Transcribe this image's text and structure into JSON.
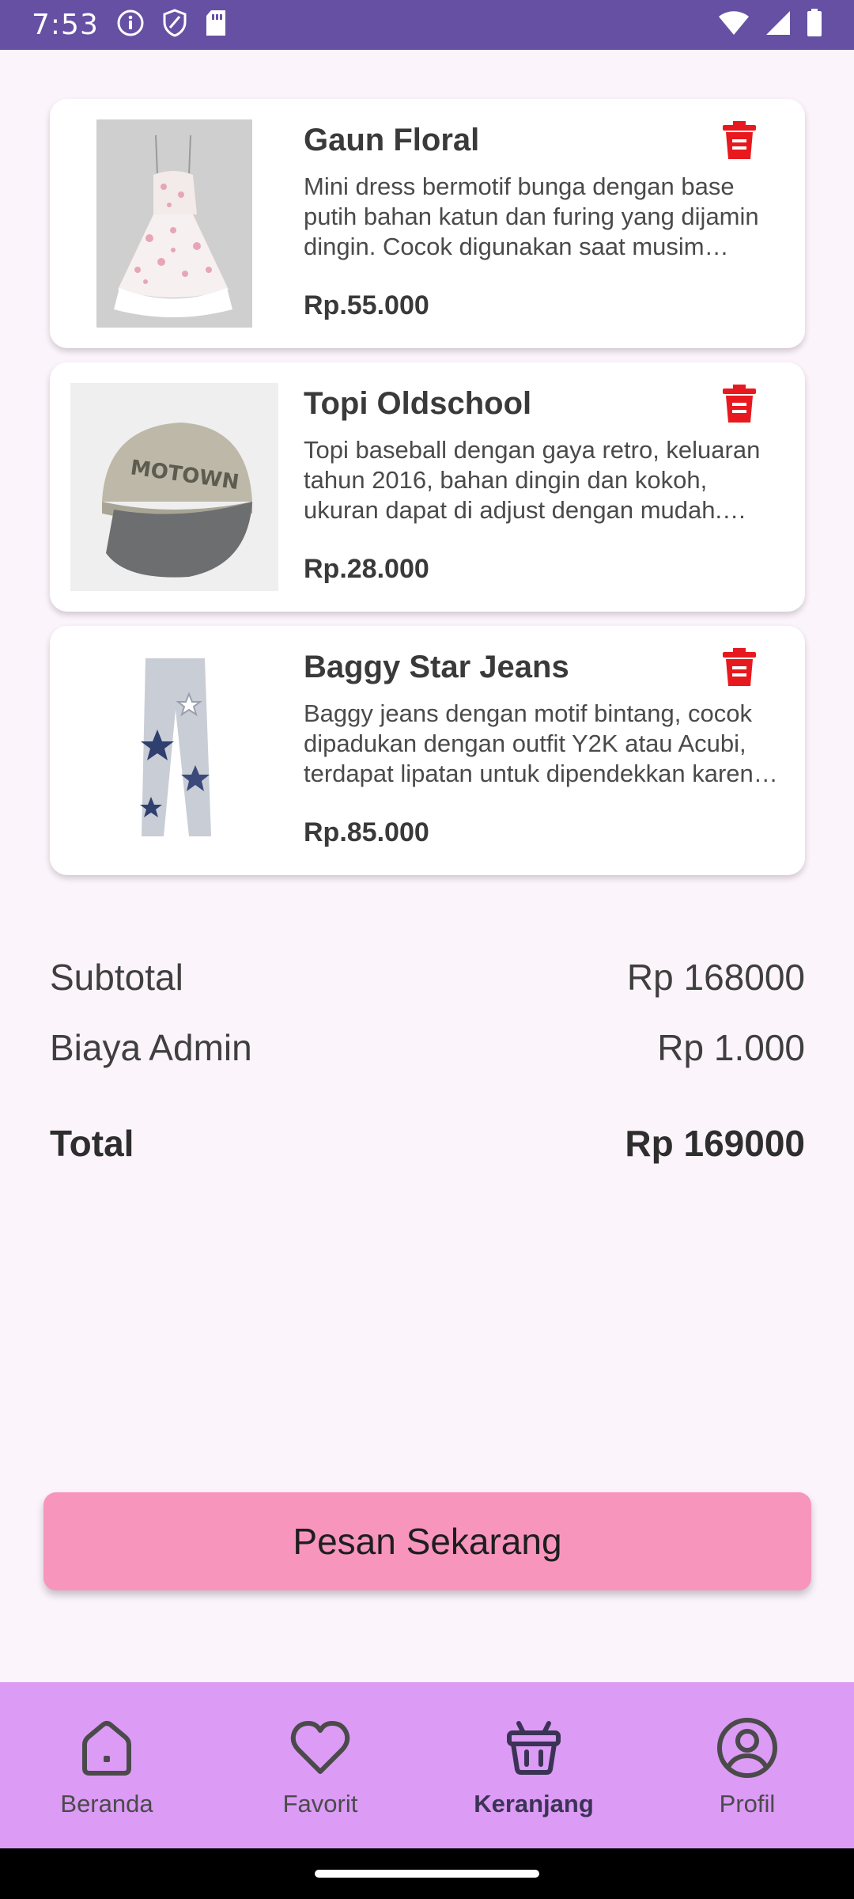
{
  "status_bar": {
    "time": "7:53",
    "icons": [
      "info-icon",
      "shield-icon",
      "sim-card-icon",
      "wifi-icon",
      "signal-icon",
      "battery-icon"
    ]
  },
  "cart": {
    "items": [
      {
        "name": "Gaun Floral",
        "description": "Mini dress bermotif bunga dengan base putih bahan katun dan furing yang dijamin dingin. Cocok digunakan saat musim panas.",
        "price": "Rp.55.000",
        "image": "floral-dress-image"
      },
      {
        "name": "Topi Oldschool",
        "description": "Topi baseball dengan gaya retro, keluaran tahun 2016, bahan dingin dan kokoh, ukuran dapat di adjust dengan mudah. Free size.",
        "price": "Rp.28.000",
        "image": "baseball-cap-image"
      },
      {
        "name": "Baggy Star Jeans",
        "description": "Baggy jeans dengan motif bintang, cocok dipadukan dengan outfit Y2K atau Acubi, terdapat lipatan untuk dipendekkan karena ukurannya panjang.",
        "price": "Rp.85.000",
        "image": "star-jeans-image"
      }
    ]
  },
  "summary": {
    "subtotal_label": "Subtotal",
    "subtotal_value": "Rp 168000",
    "admin_label": "Biaya Admin",
    "admin_value": "Rp 1.000",
    "total_label": "Total",
    "total_value": "Rp 169000"
  },
  "order_button": {
    "label": "Pesan Sekarang"
  },
  "bottom_nav": {
    "items": [
      {
        "label": "Beranda",
        "icon": "home-icon"
      },
      {
        "label": "Favorit",
        "icon": "heart-icon"
      },
      {
        "label": "Keranjang",
        "icon": "basket-icon",
        "active": true
      },
      {
        "label": "Profil",
        "icon": "profile-icon"
      }
    ]
  },
  "colors": {
    "status_bar": "#6650a4",
    "background": "#fcf4fb",
    "delete_icon": "#e8191e",
    "order_button": "#f895bd",
    "bottom_nav": "#dc9bf5"
  }
}
